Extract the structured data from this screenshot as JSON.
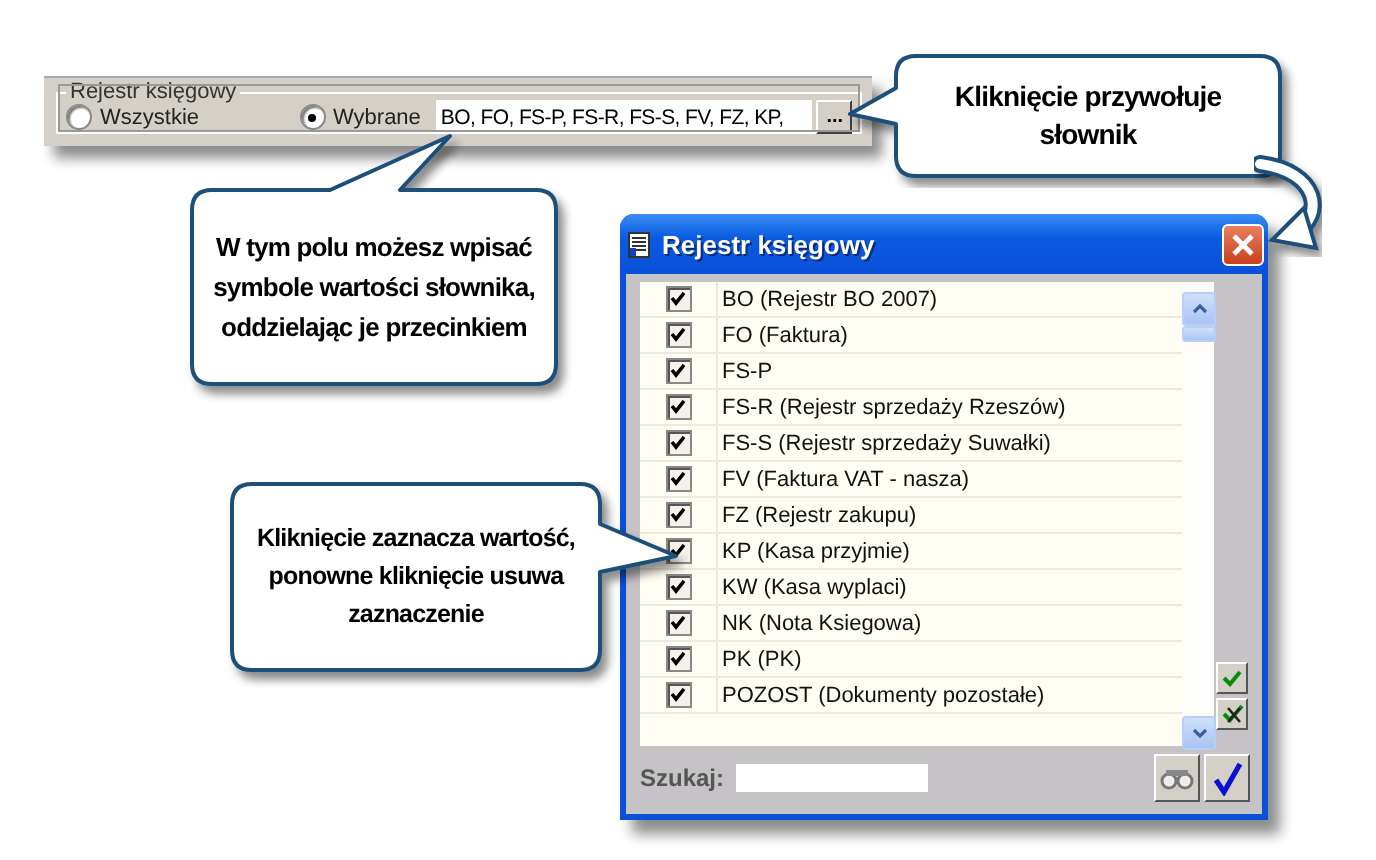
{
  "panel": {
    "group_label": "Rejestr księgowy",
    "options": [
      {
        "label": "Wszystkie",
        "selected": false
      },
      {
        "label": "Wybrane",
        "selected": true
      }
    ],
    "field_value": "BO, FO, FS-P, FS-R, FS-S, FV, FZ, KP,",
    "button_label": "..."
  },
  "callouts": [
    {
      "text": "W tym polu możesz wpisać symbole wartości słownika, oddzielając je przecinkiem"
    },
    {
      "text": "Kliknięcie przywołuje słownik"
    },
    {
      "text": "Kliknięcie zaznacza wartość, ponowne kliknięcie usuwa zaznaczenie"
    }
  ],
  "dialog": {
    "title": "Rejestr księgowy",
    "items": [
      {
        "label": "BO (Rejestr BO 2007)",
        "checked": true
      },
      {
        "label": "FO (Faktura)",
        "checked": true
      },
      {
        "label": "FS-P",
        "checked": true
      },
      {
        "label": "FS-R (Rejestr sprzedaży Rzeszów)",
        "checked": true
      },
      {
        "label": "FS-S (Rejestr sprzedaży Suwałki)",
        "checked": true
      },
      {
        "label": "FV (Faktura VAT - nasza)",
        "checked": true
      },
      {
        "label": "FZ (Rejestr zakupu)",
        "checked": true
      },
      {
        "label": "KP (Kasa przyjmie)",
        "checked": true
      },
      {
        "label": "KW (Kasa wyplaci)",
        "checked": true
      },
      {
        "label": "NK (Nota Ksiegowa)",
        "checked": true
      },
      {
        "label": "PK (PK)",
        "checked": true
      },
      {
        "label": "POZOST (Dokumenty pozostałe)",
        "checked": true
      }
    ],
    "search_label": "Szukaj:"
  }
}
